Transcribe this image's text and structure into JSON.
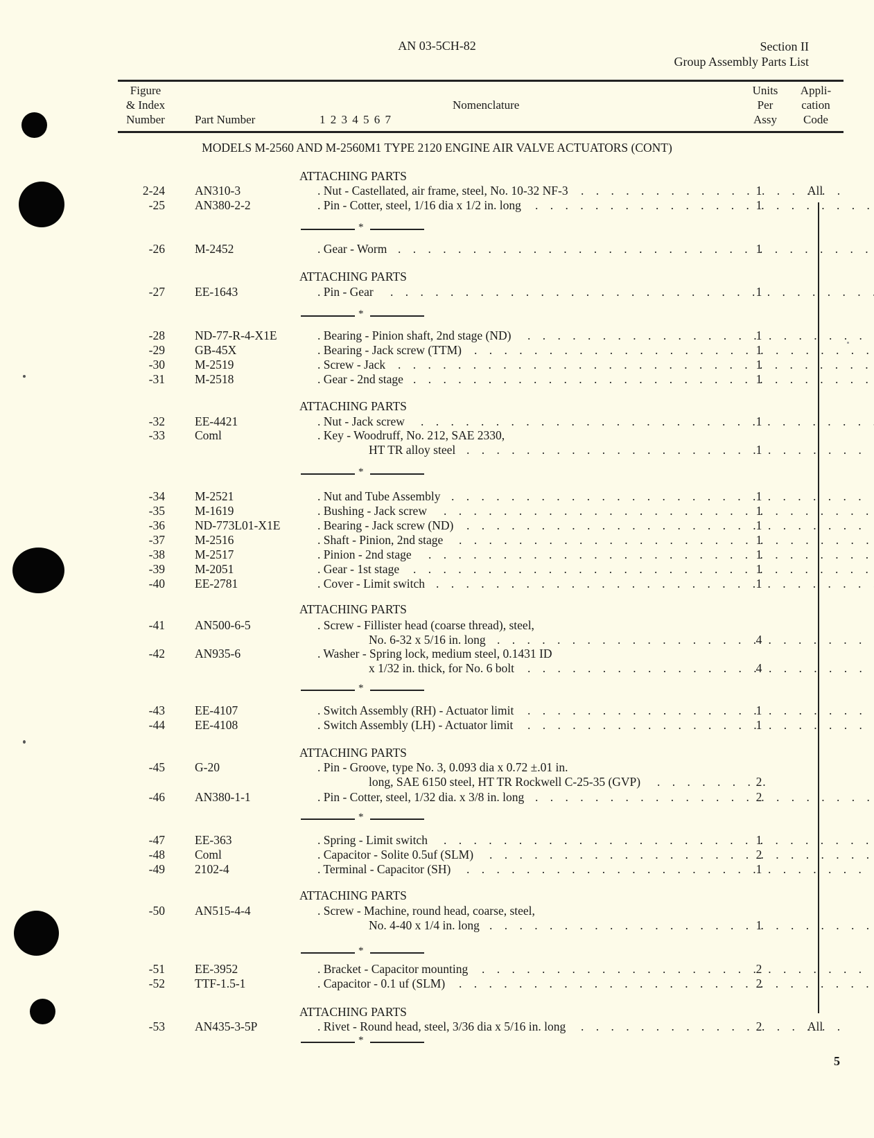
{
  "header": {
    "doc_number": "AN 03-5CH-82",
    "section": "Section II",
    "section_title": "Group Assembly Parts List"
  },
  "columns": {
    "figure_index": [
      "Figure",
      "& Index",
      "Number"
    ],
    "part_number": "Part Number",
    "indent_levels": "1 2 3 4 5 6 7",
    "nomenclature": "Nomenclature",
    "units_per_assy": [
      "Units",
      "Per",
      "Assy"
    ],
    "application_code": [
      "Appli-",
      "cation",
      "Code"
    ]
  },
  "models_title": "MODELS M-2560 AND M-2560M1 TYPE 2120 ENGINE AIR VALVE ACTUATORS (CONT)",
  "attaching_parts_label": "ATTACHING PARTS",
  "separator_symbol": "*",
  "rows": [
    {
      "index": "2-24",
      "part": "AN310-3",
      "nom": ". Nut - Castellated, air frame, steel, No. 10-32 NF-3",
      "qty": "1",
      "app": "All"
    },
    {
      "index": "-25",
      "part": "AN380-2-2",
      "nom": ". Pin - Cotter, steel, 1/16 dia  x 1/2 in. long",
      "qty": "1",
      "app": ""
    },
    {
      "index": "-26",
      "part": "M-2452",
      "nom": ". Gear - Worm",
      "qty": "1",
      "app": ""
    },
    {
      "index": "-27",
      "part": "EE-1643",
      "nom": ". Pin - Gear",
      "qty": "1",
      "app": ""
    },
    {
      "index": "-28",
      "part": "ND-77-R-4-X1E",
      "nom": ". Bearing - Pinion shaft, 2nd stage (ND)",
      "qty": "1",
      "app": ""
    },
    {
      "index": "-29",
      "part": "GB-45X",
      "nom": ". Bearing - Jack screw (TTM)",
      "qty": "1",
      "app": ""
    },
    {
      "index": "-30",
      "part": "M-2519",
      "nom": ". Screw - Jack",
      "qty": "1",
      "app": ""
    },
    {
      "index": "-31",
      "part": "M-2518",
      "nom": ". Gear - 2nd stage",
      "qty": "1",
      "app": ""
    },
    {
      "index": "-32",
      "part": "EE-4421",
      "nom": ". Nut - Jack screw",
      "qty": "1",
      "app": ""
    },
    {
      "index": "-33",
      "part": "Coml",
      "nom": ". Key - Woodruff, No. 212, SAE 2330,",
      "nom2": "HT TR alloy steel",
      "qty": "1",
      "app": ""
    },
    {
      "index": "-34",
      "part": "M-2521",
      "nom": ". Nut and Tube Assembly",
      "qty": "1",
      "app": ""
    },
    {
      "index": "-35",
      "part": "M-1619",
      "nom": ". Bushing - Jack screw",
      "qty": "1",
      "app": ""
    },
    {
      "index": "-36",
      "part": "ND-773L01-X1E",
      "nom": ". Bearing - Jack screw (ND)",
      "qty": "1",
      "app": ""
    },
    {
      "index": "-37",
      "part": "M-2516",
      "nom": ". Shaft - Pinion, 2nd stage",
      "qty": "1",
      "app": ""
    },
    {
      "index": "-38",
      "part": "M-2517",
      "nom": ". Pinion - 2nd stage",
      "qty": "1",
      "app": ""
    },
    {
      "index": "-39",
      "part": "M-2051",
      "nom": ". Gear - 1st stage",
      "qty": "1",
      "app": ""
    },
    {
      "index": "-40",
      "part": "EE-2781",
      "nom": ". Cover - Limit switch",
      "qty": "1",
      "app": ""
    },
    {
      "index": "-41",
      "part": "AN500-6-5",
      "nom": ". Screw - Fillister head (coarse thread), steel,",
      "nom2": "No. 6-32 x 5/16 in. long",
      "qty": "4",
      "app": ""
    },
    {
      "index": "-42",
      "part": "AN935-6",
      "nom": ". Washer - Spring lock, medium steel, 0.1431 ID",
      "nom2": "x 1/32 in. thick, for No. 6 bolt",
      "qty": "4",
      "app": ""
    },
    {
      "index": "-43",
      "part": "EE-4107",
      "nom": ". Switch Assembly (RH) - Actuator limit",
      "qty": "1",
      "app": ""
    },
    {
      "index": "-44",
      "part": "EE-4108",
      "nom": ". Switch Assembly (LH) - Actuator limit",
      "qty": "1",
      "app": ""
    },
    {
      "index": "-45",
      "part": "G-20",
      "nom": ". Pin - Groove, type No. 3, 0.093 dia  x 0.72 ±.01 in.",
      "nom2": "long, SAE 6150 steel, HT TR Rockwell C-25-35 (GVP)",
      "qty": "2",
      "app": ""
    },
    {
      "index": "-46",
      "part": "AN380-1-1",
      "nom": ". Pin - Cotter, steel, 1/32 dia. x 3/8 in. long",
      "qty": "2",
      "app": ""
    },
    {
      "index": "-47",
      "part": "EE-363",
      "nom": ". Spring - Limit switch",
      "qty": "1",
      "app": ""
    },
    {
      "index": "-48",
      "part": "Coml",
      "nom": ". Capacitor - Solite 0.5uf (SLM)",
      "qty": "2",
      "app": ""
    },
    {
      "index": "-49",
      "part": "2102-4",
      "nom": ". Terminal - Capacitor (SH)",
      "qty": "1",
      "app": ""
    },
    {
      "index": "-50",
      "part": "AN515-4-4",
      "nom": ". Screw - Machine, round head, coarse, steel,",
      "nom2": "No. 4-40 x 1/4 in. long",
      "qty": "1",
      "app": ""
    },
    {
      "index": "-51",
      "part": "EE-3952",
      "nom": ". Bracket - Capacitor mounting",
      "qty": "2",
      "app": ""
    },
    {
      "index": "-52",
      "part": "TTF-1.5-1",
      "nom": ". Capacitor - 0.1 uf (SLM)",
      "qty": "2",
      "app": ""
    },
    {
      "index": "-53",
      "part": "AN435-3-5P",
      "nom": ". Rivet - Round head, steel, 3/36 dia  x 5/16 in. long",
      "qty": "2",
      "app": "All"
    }
  ],
  "page_number": "5"
}
